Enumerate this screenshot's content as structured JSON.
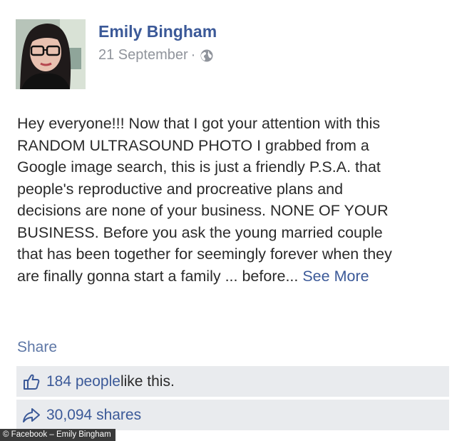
{
  "post": {
    "author": "Emily Bingham",
    "date": "21 September",
    "separator": "·",
    "privacy_icon": "globe-icon",
    "body_lines": [
      "Hey everyone!!! Now that I got your attention with this",
      "RANDOM ULTRASOUND PHOTO I grabbed from a",
      "Google image search, this is just a friendly P.S.A. that",
      "people's reproductive and procreative plans and",
      "decisions are none of your business. NONE OF YOUR",
      "BUSINESS. Before you ask the young married couple",
      "that has been together for seemingly forever when they",
      "are finally gonna start a family ... before..."
    ],
    "see_more": "See More",
    "share": "Share"
  },
  "likes": {
    "icon": "thumbs-up-icon",
    "count_text": "184 people",
    "suffix": " like this."
  },
  "shares": {
    "icon": "share-arrow-icon",
    "text": "30,094 shares"
  },
  "caption": "© Facebook – Emily Bingham",
  "colors": {
    "link": "#3b5998",
    "meta": "#90949c",
    "stat_bg": "#e9ebee"
  }
}
